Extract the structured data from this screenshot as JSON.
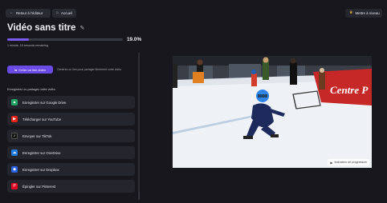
{
  "topbar": {
    "back_label": "Retour à l'éditeur",
    "back_icon": "arrow-left-icon",
    "home_label": "Accueil",
    "home_icon": "home-icon",
    "upgrade_label": "Mettre à niveau",
    "upgrade_icon": "crown-icon"
  },
  "project": {
    "title": "Vidéo sans titre",
    "edit_icon": "pencil-icon",
    "progress_percent_label": "19.0%",
    "progress_fraction": 0.19,
    "remaining_text": "1 minute, 15 seconds remaining"
  },
  "create": {
    "button_label": "Créer un lien vidéo",
    "button_icon": "link-icon",
    "note": "Générez un lien pour partager librement votre vidéo"
  },
  "share": {
    "section_label": "Enregistrez ou partagez cette vidéo",
    "items": [
      {
        "label": "Enregistrer sur Google Drive",
        "icon": "google-drive-icon",
        "color": "#1fa463"
      },
      {
        "label": "Télécharger sur YouTube",
        "icon": "youtube-icon",
        "color": "#e62117"
      },
      {
        "label": "Envoyer sur TikTok",
        "icon": "tiktok-icon",
        "color": "#111111"
      },
      {
        "label": "Enregistrer sur OneDrive",
        "icon": "onedrive-icon",
        "color": "#1e7be0"
      },
      {
        "label": "Enregistrer sur Dropbox",
        "icon": "dropbox-icon",
        "color": "#2a62e8"
      },
      {
        "label": "Épingler sur Pinterest",
        "icon": "pinterest-icon",
        "color": "#e60023"
      }
    ]
  },
  "preview": {
    "banner_text": "Centre P",
    "watermark_label": "Indicateur de progression",
    "watermark_icon": "play-icon",
    "colors": {
      "ice": "#eef2f6",
      "banner": "#d52b2b",
      "board": "#c62828"
    }
  }
}
